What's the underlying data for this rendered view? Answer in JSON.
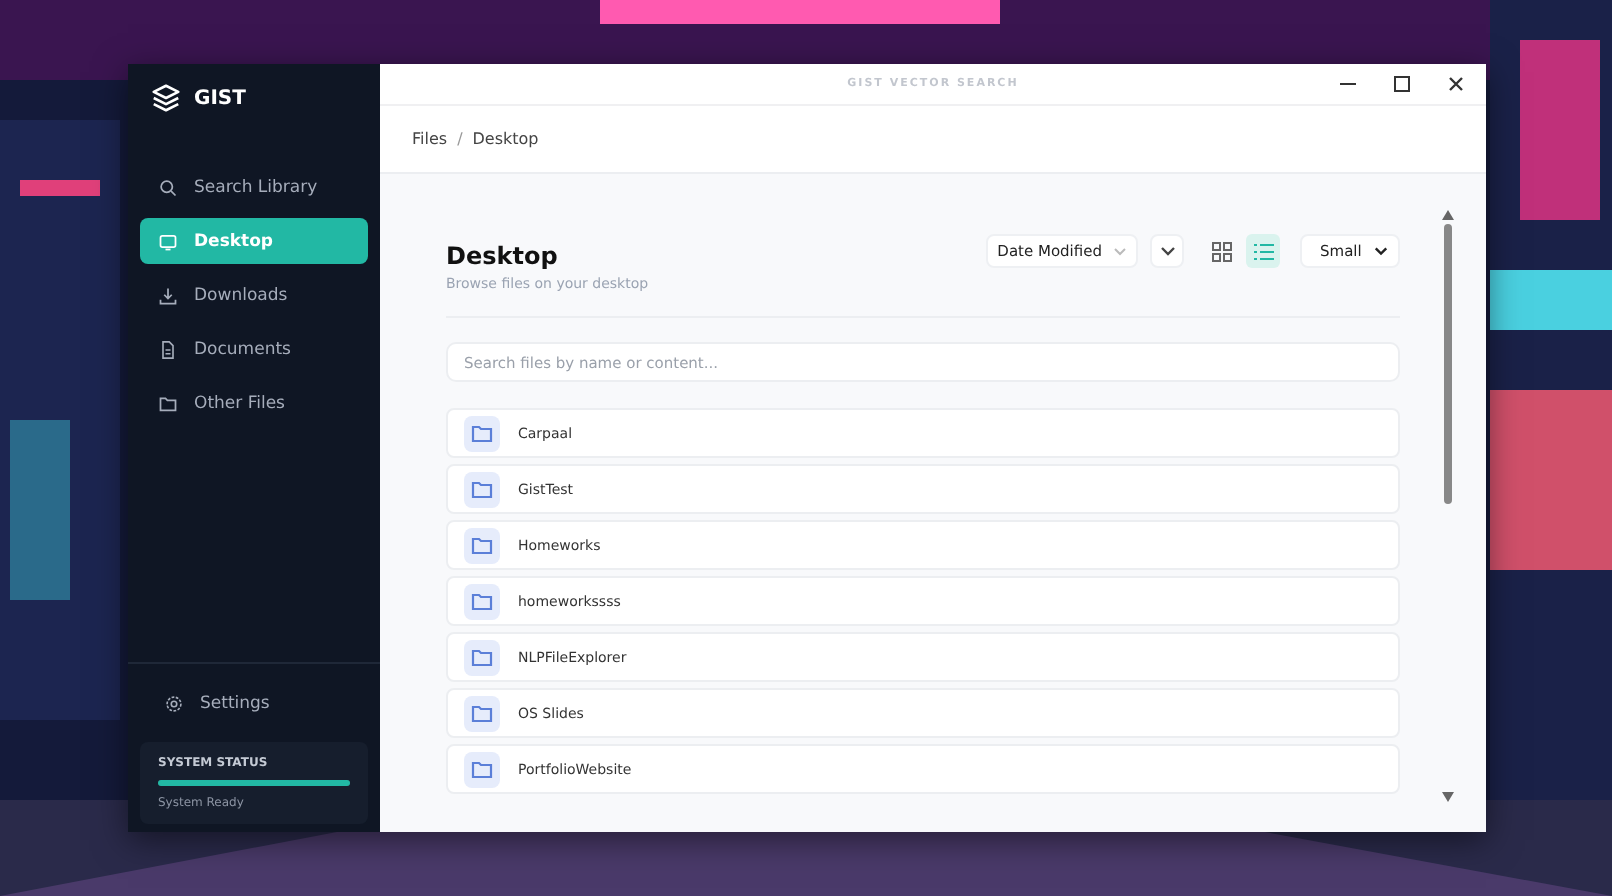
{
  "window": {
    "title": "GIST VECTOR SEARCH"
  },
  "sidebar": {
    "brand": "GIST",
    "items": [
      {
        "label": "Search Library",
        "kind": "search",
        "selected": false
      },
      {
        "label": "Desktop",
        "kind": "monitor",
        "selected": true
      },
      {
        "label": "Downloads",
        "kind": "download",
        "selected": false
      },
      {
        "label": "Documents",
        "kind": "document",
        "selected": false
      },
      {
        "label": "Other Files",
        "kind": "folder",
        "selected": false
      }
    ],
    "settings": "Settings",
    "system_status": {
      "label": "SYSTEM STATUS",
      "level": 1,
      "text": "System Ready"
    }
  },
  "breadcrumb": {
    "items": [
      "Files",
      "Desktop"
    ],
    "separator": "/"
  },
  "header": {
    "title": "Desktop",
    "subtitle": "Browse files on your desktop"
  },
  "toolbar": {
    "sort": "Date Modified",
    "views": [
      {
        "kind": "grid",
        "selected": false
      },
      {
        "kind": "list",
        "selected": true
      }
    ],
    "size": "Small"
  },
  "search": {
    "placeholder": "Search files by name or content..."
  },
  "files": [
    {
      "name": "Carpaal"
    },
    {
      "name": "GistTest"
    },
    {
      "name": "Homeworks"
    },
    {
      "name": "homeworkssss"
    },
    {
      "name": "NLPFileExplorer"
    },
    {
      "name": "OS Slides"
    },
    {
      "name": "PortfolioWebsite"
    }
  ]
}
